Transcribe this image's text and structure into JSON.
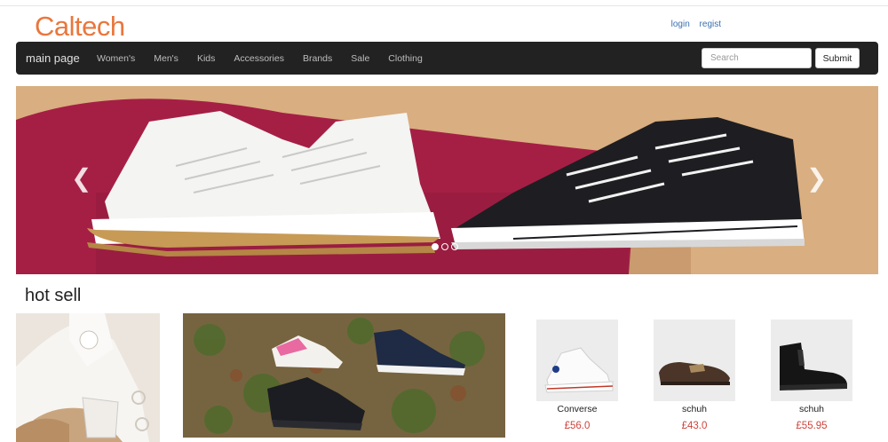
{
  "header": {
    "logo": "Caltech",
    "login": "login",
    "register": "regist"
  },
  "navbar": {
    "brand": "main page",
    "items": [
      "Women's",
      "Men's",
      "Kids",
      "Accessories",
      "Brands",
      "Sale",
      "Clothing"
    ],
    "search_placeholder": "Search",
    "submit_label": "Submit"
  },
  "carousel": {
    "prev_icon": "chevron-left-icon",
    "next_icon": "chevron-right-icon",
    "slide_count": 3,
    "active_slide": 1
  },
  "hot_sell": {
    "title": "hot sell",
    "products": [
      {
        "name": "Converse",
        "price": "£56.0"
      },
      {
        "name": "schuh",
        "price": "£43.0"
      },
      {
        "name": "schuh",
        "price": "£55.95"
      }
    ]
  },
  "colors": {
    "accent": "#e9773c",
    "navbar": "#222222",
    "link": "#3a6fb0",
    "price": "#d0433b"
  }
}
